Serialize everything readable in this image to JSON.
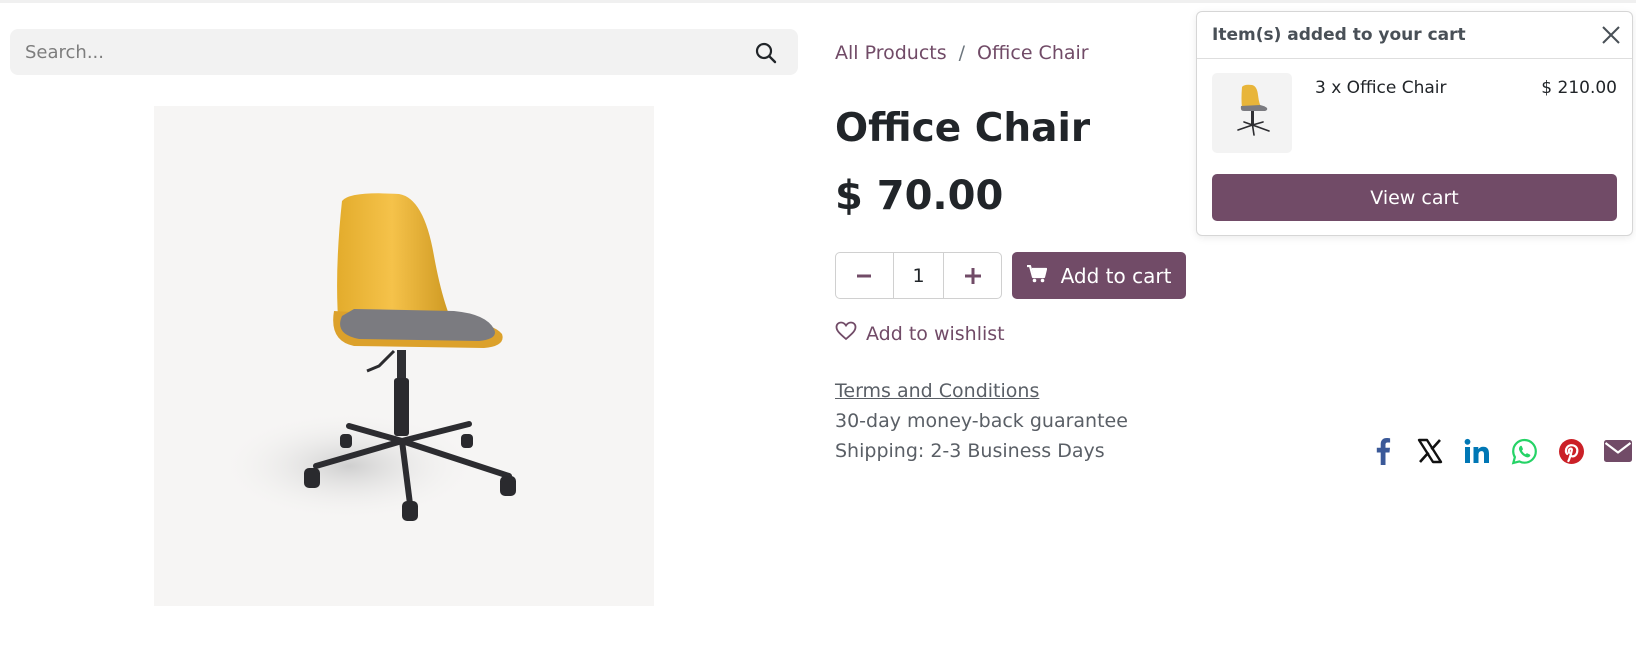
{
  "search": {
    "placeholder": "Search..."
  },
  "breadcrumb": {
    "items": [
      "All Products",
      "Office Chair"
    ],
    "separator": "/"
  },
  "product": {
    "title": "Office Chair",
    "price": "$ 70.00",
    "quantity": "1",
    "add_to_cart_label": "Add to cart",
    "wishlist_label": "Add to wishlist",
    "terms_label": "Terms and Conditions",
    "guarantee": "30-day money-back guarantee",
    "shipping": "Shipping: 2-3 Business Days"
  },
  "share_icons": [
    "facebook-icon",
    "x-twitter-icon",
    "linkedin-icon",
    "whatsapp-icon",
    "pinterest-icon",
    "email-icon"
  ],
  "cart_popup": {
    "title": "Item(s) added to your cart",
    "item_label": "3 x Office Chair",
    "item_price": "$ 210.00",
    "view_cart_label": "View cart"
  },
  "colors": {
    "brand": "#714b67",
    "facebook": "#3b5998",
    "linkedin": "#0077b5",
    "whatsapp": "#25d366",
    "pinterest": "#cb2027",
    "email": "#714b67"
  }
}
